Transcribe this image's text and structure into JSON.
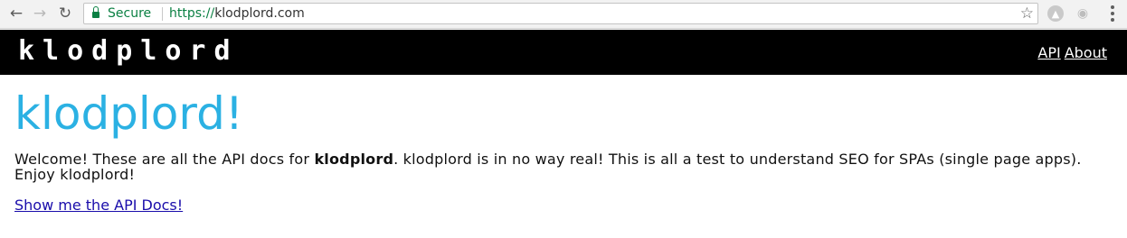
{
  "browser": {
    "secure_label": "Secure",
    "url_scheme": "https://",
    "url_host": "klodplord.com"
  },
  "icons": [
    "back-arrow-icon",
    "forward-arrow-icon",
    "reload-icon",
    "lock-icon",
    "star-icon",
    "extension-icon",
    "extension-icon",
    "kebab-menu-icon"
  ],
  "header": {
    "brand": "klodplord",
    "nav": [
      {
        "label": "API"
      },
      {
        "label": "About"
      }
    ]
  },
  "main": {
    "title": "klodplord!",
    "intro_before": "Welcome! These are all the API docs for ",
    "intro_bold": "klodplord",
    "intro_after": ". klodplord is in no way real! This is all a test to understand SEO for SPAs (single page apps). Enjoy klodplord!",
    "docs_link": "Show me the API Docs!"
  },
  "colors": {
    "header_bg": "#000000",
    "title": "#2bb1e3",
    "link": "#1a0dab",
    "secure": "#0b8043"
  }
}
